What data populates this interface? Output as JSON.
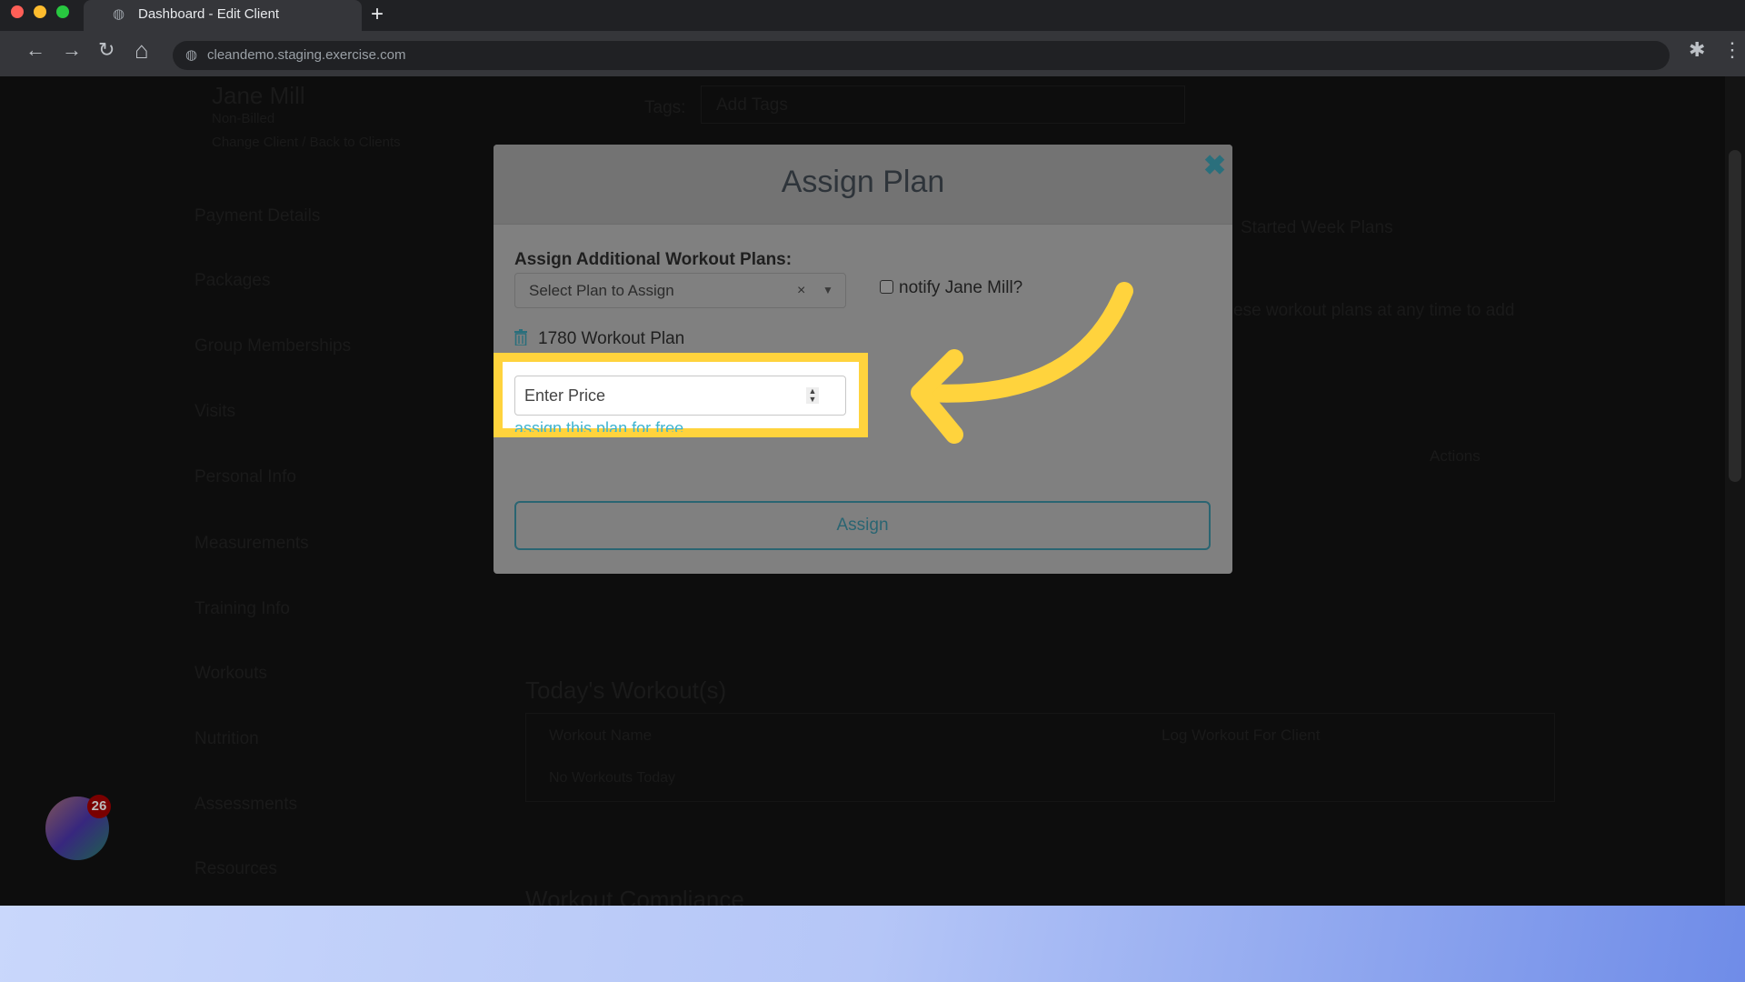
{
  "browser": {
    "tab_title": "Dashboard - Edit Client",
    "url": "cleandemo.staging.exercise.com",
    "new_tab": "+",
    "back": "←",
    "forward": "→",
    "reload": "↻",
    "home": "⌂",
    "star": "☆",
    "extensions": "✱",
    "menu": "⋮",
    "globe": "◍"
  },
  "client": {
    "name": "Jane Mill",
    "status": "Non-Billed",
    "links": "Change Client / Back to Clients",
    "tags_label": "Tags:",
    "tags_placeholder": "Add Tags"
  },
  "sidebar": {
    "items": [
      "Payment Details",
      "Packages",
      "Group Memberships",
      "Visits",
      "Personal Info",
      "Measurements",
      "Training Info",
      "Workouts",
      "Nutrition",
      "Assessments",
      "Resources"
    ]
  },
  "main": {
    "started_week_plans": "Started Week Plans",
    "plans_hint": "ese workout plans at any time to add",
    "actions_header": "Actions",
    "todays_title": "Today's Workout(s)",
    "col_workout_name": "Workout Name",
    "col_log": "Log Workout For Client",
    "empty": "No Workouts Today",
    "compliance_title": "Workout Compliance"
  },
  "modal": {
    "title": "Assign Plan",
    "close": "✖",
    "label": "Assign Additional Workout Plans:",
    "select_placeholder": "Select Plan to Assign",
    "select_clear": "×",
    "select_caret": "▼",
    "notify_label": "notify Jane Mill?",
    "notify_checked": false,
    "plan_name": "1780 Workout Plan",
    "price_placeholder": "Enter Price",
    "free_link": "assign this plan for free",
    "assign_button": "Assign"
  },
  "annotation": {
    "highlight_color": "#ffd33d"
  },
  "widget": {
    "badge_count": "26"
  }
}
